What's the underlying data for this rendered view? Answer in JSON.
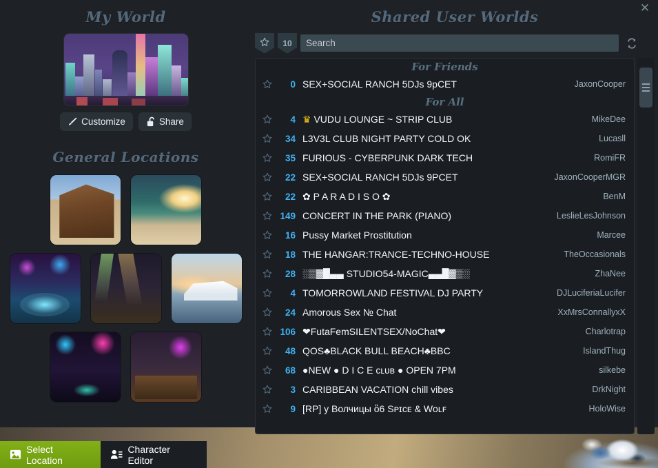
{
  "window": {
    "close_label": "✕"
  },
  "left": {
    "my_world_title": "My World",
    "general_locations_title": "General Locations",
    "customize_label": "Customize",
    "share_label": "Share",
    "world_preview_name": "cyberpunk-city-preview",
    "locations": [
      {
        "name": "western-saloon"
      },
      {
        "name": "tropical-beach"
      },
      {
        "name": "pool-party"
      },
      {
        "name": "neon-venue"
      },
      {
        "name": "sunset-yacht"
      },
      {
        "name": "neon-dance-club"
      },
      {
        "name": "sin-club-bar"
      }
    ]
  },
  "right": {
    "title": "Shared User Worlds",
    "favorites_tab_icon": "star-icon",
    "count_badge": "10",
    "search_placeholder": "Search",
    "refresh_icon": "refresh-icon",
    "sections": [
      {
        "label": "For Friends",
        "rows": [
          {
            "count": "0",
            "title": "SEX+SOCIAL RANCH 5DJs 9pCET",
            "owner": "JaxonCooper"
          }
        ]
      },
      {
        "label": "For All",
        "rows": [
          {
            "count": "4",
            "title": "♛ VUDU LOUNGE ~ STRIP CLUB",
            "owner": "MikeDee",
            "crown": true
          },
          {
            "count": "34",
            "title": "L3V3L CLUB NIGHT PARTY COLD OK",
            "owner": "Lucasll"
          },
          {
            "count": "35",
            "title": "FURIOUS - CYBERPUNK DARK TECH",
            "owner": "RomiFR"
          },
          {
            "count": "22",
            "title": "SEX+SOCIAL RANCH 5DJs 9PCET",
            "owner": "JaxonCooperMGR"
          },
          {
            "count": "22",
            "title": "✿ P A R A D I S O ✿",
            "owner": "BenM"
          },
          {
            "count": "149",
            "title": "CONCERT IN THE PARK (PIANO)",
            "owner": "LeslieLesJohnson"
          },
          {
            "count": "16",
            "title": "Pussy Market Prostitution",
            "owner": "Marcee"
          },
          {
            "count": "18",
            "title": "THE HANGAR:TRANCE-TECHNO-HOUSE",
            "owner": "TheOccasionals"
          },
          {
            "count": "28",
            "title": "░▒▓█▄▄ STUDIO54-MAGIC▄▄█▓▒░",
            "owner": "ZhaNee"
          },
          {
            "count": "4",
            "title": "TOMORROWLAND FESTIVAL DJ PARTY",
            "owner": "DJLuciferiaLucifer"
          },
          {
            "count": "24",
            "title": "Amorous Sex № Chat",
            "owner": "XxMrsConnallyxX"
          },
          {
            "count": "106",
            "title": "❤FutaFemSILENTSEX/NoChat❤",
            "owner": "Charlotrap"
          },
          {
            "count": "48",
            "title": "QOS♣BLACK BULL BEACH♣BBC",
            "owner": "IslandThug"
          },
          {
            "count": "68",
            "title": "●NEW ● D I C E ᴄʟᴜʙ ● OPEN 7PM",
            "owner": "silkebe"
          },
          {
            "count": "3",
            "title": "CARIBBEAN VACATION chill vibes",
            "owner": "DrkNight"
          },
          {
            "count": "9",
            "title": "[RP] у Волчицы ὃ6 Sᴘɪᴄᴇ & Wᴏʟꜰ",
            "owner": "HoloWise"
          }
        ]
      }
    ]
  },
  "bottom": {
    "tabs": [
      {
        "label": "Select Location",
        "icon": "image-icon",
        "active": true
      },
      {
        "label": "Character Editor",
        "icon": "person-list-icon",
        "active": false
      }
    ]
  },
  "colors": {
    "bg": "#1e2227",
    "panel": "#1a1e23",
    "accent_count": "#3fb2f2",
    "heading": "#55697a",
    "active_tab_green": "#81b017",
    "crown_gold": "#f6c518"
  }
}
